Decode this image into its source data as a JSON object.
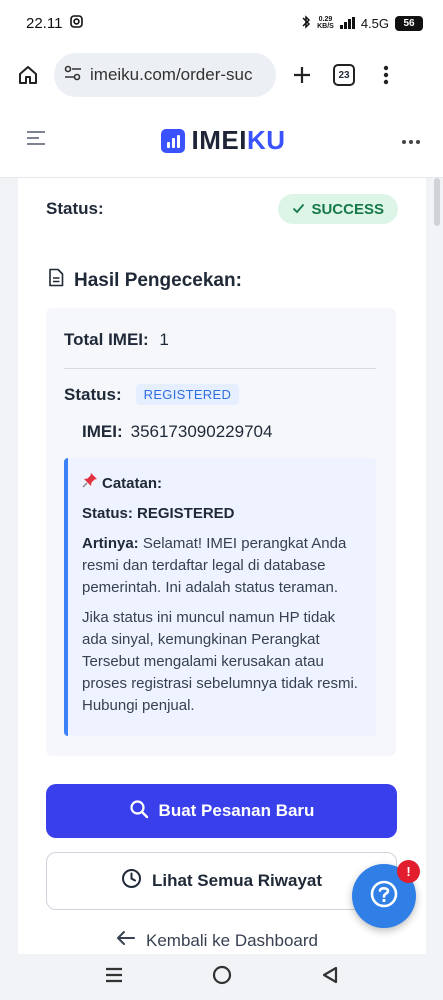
{
  "status_bar": {
    "time": "22.11",
    "speed_top": "0.29",
    "speed_unit": "KB/S",
    "network": "4.5G",
    "battery": "56"
  },
  "browser": {
    "url": "imeiku.com/order-suc",
    "tab_count": "23"
  },
  "site": {
    "logo_part1": "IMEI",
    "logo_part2": "KU"
  },
  "order": {
    "status_label": "Status:",
    "status_value": "SUCCESS"
  },
  "result": {
    "title": "Hasil Pengecekan:",
    "total_label": "Total IMEI:",
    "total_value": "1",
    "status_label": "Status:",
    "status_value": "REGISTERED",
    "imei_label": "IMEI:",
    "imei_value": "356173090229704"
  },
  "note": {
    "title": "Catatan:",
    "status_line": "Status: REGISTERED",
    "meaning_label": "Artinya:",
    "meaning_text": "Selamat! IMEI perangkat Anda resmi dan terdaftar legal di database pemerintah. Ini adalah status teraman.",
    "warning_text": "Jika status ini muncul namun HP tidak ada sinyal, kemungkinan Perangkat Tersebut mengalami kerusakan atau proses registrasi sebelumnya tidak resmi. Hubungi penjual."
  },
  "actions": {
    "new_order": "Buat Pesanan Baru",
    "view_history": "Lihat Semua Riwayat",
    "back_dashboard": "Kembali ke Dashboard"
  },
  "help": {
    "badge": "!"
  },
  "colors": {
    "brand": "#3b52ff",
    "primary_button": "#3a3fec",
    "success_bg": "#dcf5e6",
    "success_text": "#16794a",
    "note_accent": "#3b82f6",
    "help_fab": "#2f7fe6"
  }
}
